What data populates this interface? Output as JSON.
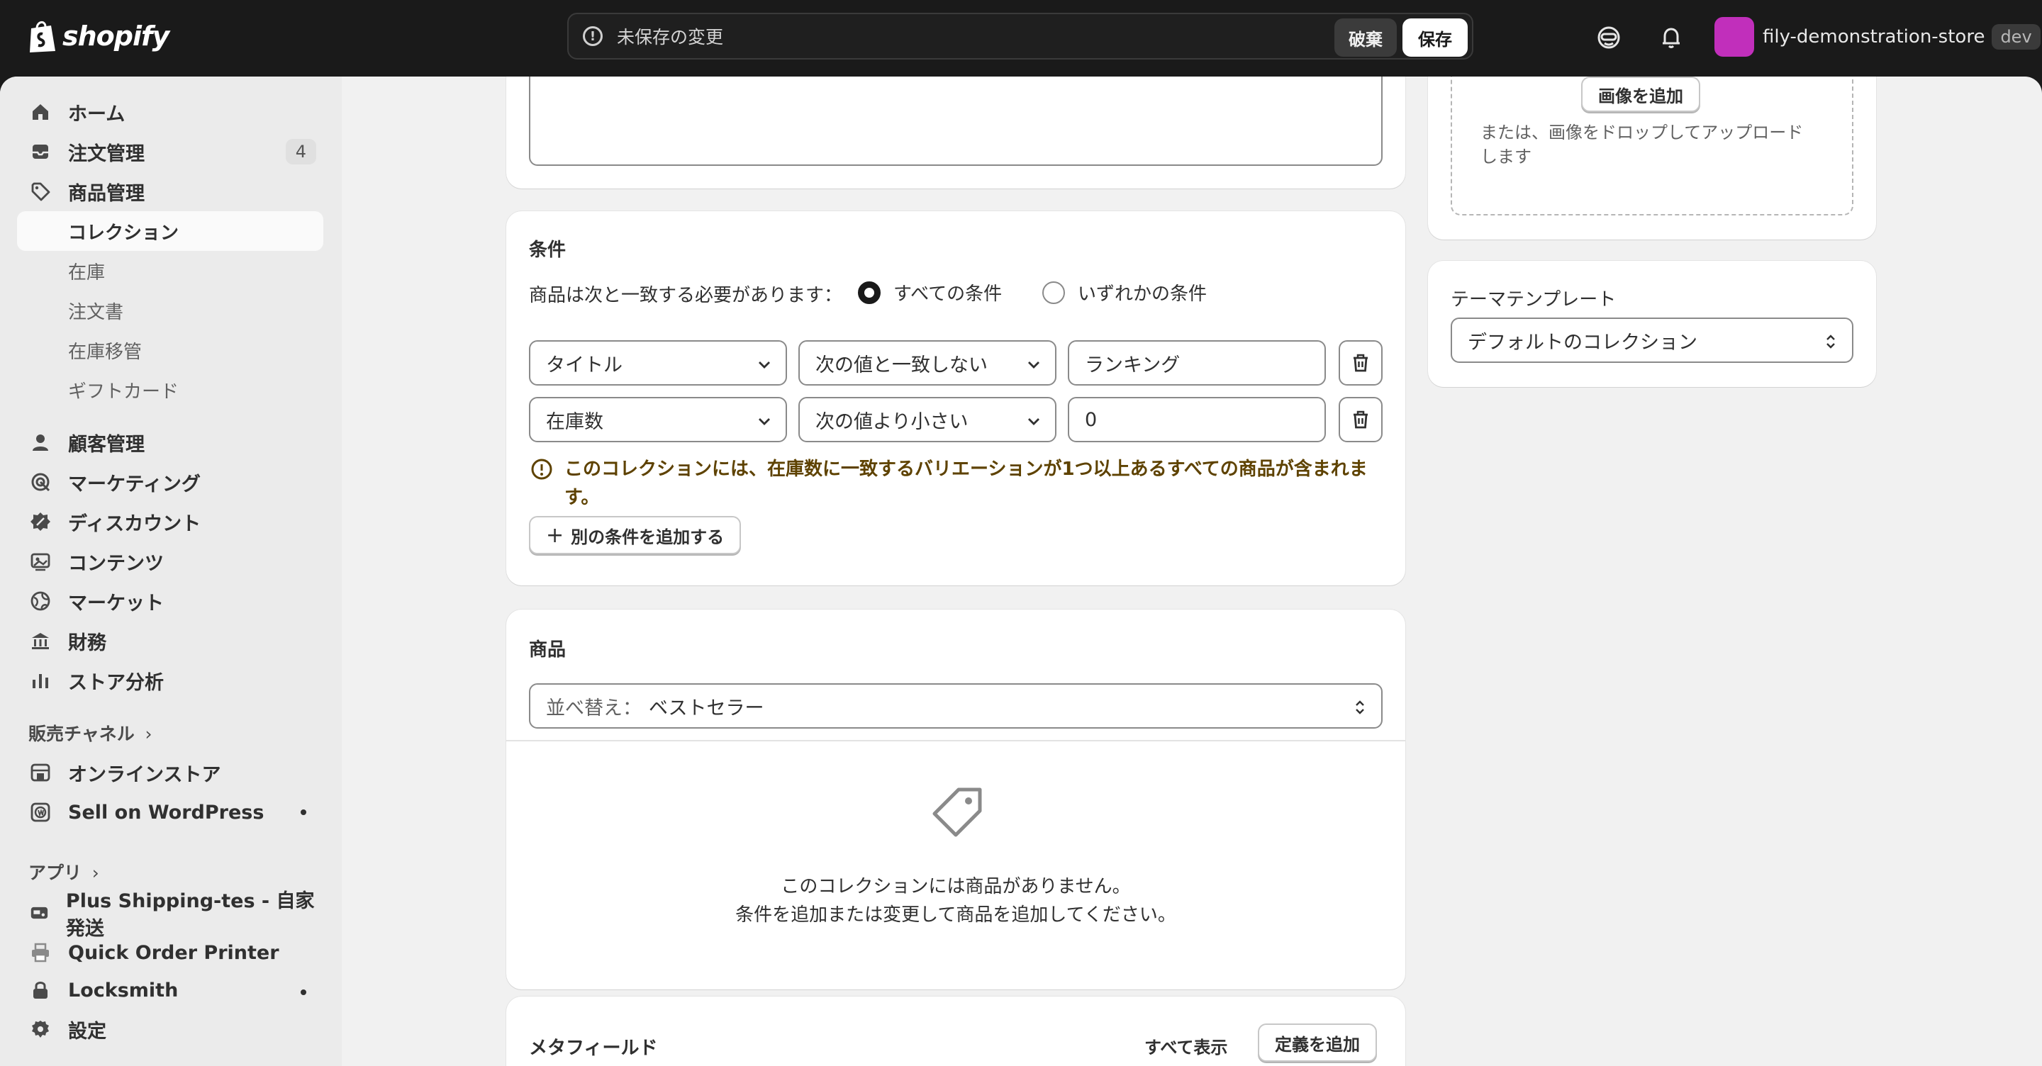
{
  "topbar": {
    "brand": "shopify",
    "unsaved_message": "未保存の変更",
    "discard_label": "破棄",
    "save_label": "保存",
    "store_name": "fily-demonstration-store",
    "store_badge": "dev",
    "store_color": "#c12fbb"
  },
  "sidebar": {
    "items": [
      {
        "label": "ホーム",
        "icon": "home-icon"
      },
      {
        "label": "注文管理",
        "icon": "inbox-icon",
        "count": "4"
      },
      {
        "label": "商品管理",
        "icon": "tag-icon"
      },
      {
        "label": "コレクション"
      },
      {
        "label": "在庫"
      },
      {
        "label": "注文書"
      },
      {
        "label": "在庫移管"
      },
      {
        "label": "ギフトカード"
      },
      {
        "label": "顧客管理",
        "icon": "person-icon"
      },
      {
        "label": "マーケティング",
        "icon": "target-icon"
      },
      {
        "label": "ディスカウント",
        "icon": "discount-icon"
      },
      {
        "label": "コンテンツ",
        "icon": "content-icon"
      },
      {
        "label": "マーケット",
        "icon": "globe-icon"
      },
      {
        "label": "財務",
        "icon": "bank-icon"
      },
      {
        "label": "ストア分析",
        "icon": "chart-icon"
      }
    ],
    "sales_channels_label": "販売チャネル",
    "channels": [
      {
        "label": "オンラインストア",
        "icon": "store-icon"
      },
      {
        "label": "Sell on WordPress",
        "icon": "wordpress-icon"
      }
    ],
    "apps_label": "アプリ",
    "apps": [
      {
        "label": "Plus Shipping-tes - 自家発送",
        "icon": "shipping-app-icon"
      },
      {
        "label": "Quick Order Printer",
        "icon": "printer-app-icon"
      },
      {
        "label": "Locksmith",
        "icon": "lock-app-icon"
      }
    ],
    "settings_label": "設定"
  },
  "conditions": {
    "title": "条件",
    "match_label": "商品は次と一致する必要があります：",
    "all_label": "すべての条件",
    "any_label": "いずれかの条件",
    "rows": [
      {
        "field": "タイトル",
        "operator": "次の値と一致しない",
        "value": "ランキング"
      },
      {
        "field": "在庫数",
        "operator": "次の値より小さい",
        "value": "0"
      }
    ],
    "warning": "このコレクションには、在庫数に一致するバリエーションが1つ以上あるすべての商品が含まれます。",
    "add_condition_label": "別の条件を追加する"
  },
  "products": {
    "title": "商品",
    "sort_prefix": "並べ替え：",
    "sort_value": "ベストセラー",
    "empty_line1": "このコレクションには商品がありません。",
    "empty_line2": "条件を追加または変更して商品を追加してください。"
  },
  "metafields": {
    "title": "メタフィールド",
    "view_all_label": "すべて表示",
    "add_definition_label": "定義を追加"
  },
  "image": {
    "add_image_label": "画像を追加",
    "drop_hint": "または、画像をドロップしてアップロードします"
  },
  "theme": {
    "title": "テーマテンプレート",
    "value": "デフォルトのコレクション"
  }
}
